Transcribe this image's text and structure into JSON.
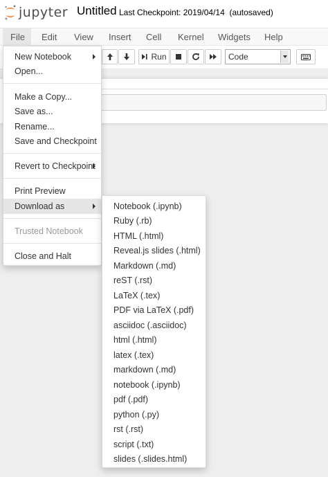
{
  "header": {
    "logo_text": "jupyter",
    "notebook_name": "Untitled",
    "checkpoint_text": "Last Checkpoint: 2019/04/14",
    "autosave_text": "(autosaved)"
  },
  "menubar": {
    "items": [
      "File",
      "Edit",
      "View",
      "Insert",
      "Cell",
      "Kernel",
      "Widgets",
      "Help"
    ],
    "open_item": "File"
  },
  "toolbar": {
    "run_label": "Run",
    "cell_type": "Code"
  },
  "file_menu": {
    "new_notebook": "New Notebook",
    "open": "Open...",
    "make_copy": "Make a Copy...",
    "save_as": "Save as...",
    "rename": "Rename...",
    "save_checkpoint": "Save and Checkpoint",
    "revert": "Revert to Checkpoint",
    "print_preview": "Print Preview",
    "download_as": "Download as",
    "trusted": "Trusted Notebook",
    "close_halt": "Close and Halt"
  },
  "download_menu": {
    "items": [
      "Notebook (.ipynb)",
      "Ruby (.rb)",
      "HTML (.html)",
      "Reveal.js slides (.html)",
      "Markdown (.md)",
      "reST (.rst)",
      "LaTeX (.tex)",
      "PDF via LaTeX (.pdf)",
      "asciidoc (.asciidoc)",
      "html (.html)",
      "latex (.tex)",
      "markdown (.md)",
      "notebook (.ipynb)",
      "pdf (.pdf)",
      "python (.py)",
      "rst (.rst)",
      "script (.txt)",
      "slides (.slides.html)"
    ]
  },
  "colors": {
    "logo_orange": "#f37626",
    "menu_active_bg": "#e6e6e6"
  }
}
